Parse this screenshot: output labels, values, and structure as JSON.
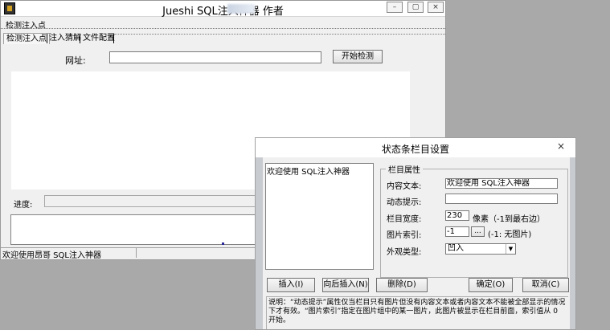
{
  "main": {
    "title": "Jueshi SQL注入神器 作者",
    "menu": "检测注入点",
    "tabs": [
      "检测注入点",
      "注入猜解",
      "文件配置"
    ],
    "url_label": "网址:",
    "url_value": "",
    "start_button": "开始检测",
    "progress_label": "进度:",
    "status_text": "欢迎使用昂哥 SQL注入神器"
  },
  "dialog": {
    "title": "状态条栏目设置",
    "close_glyph": "×",
    "list_items": [
      "欢迎使用 SQL注入神器"
    ],
    "group_title": "栏目属性",
    "labels": {
      "content": "内容文本:",
      "tip": "动态提示:",
      "width": "栏目宽度:",
      "image": "图片索引:",
      "shape": "外观类型:"
    },
    "content_value": "欢迎使用 SQL注入神器",
    "tip_value": "",
    "width_value": "230",
    "width_hint": "像素（-1到最右边）",
    "image_value": "-1",
    "image_button": "...",
    "image_hint": "(-1: 无图片)",
    "shape_value": "凹入",
    "buttons": {
      "insert": "插入(I)",
      "insert_after": "向后插入(N)",
      "delete": "删除(D)",
      "ok": "确定(O)",
      "cancel": "取消(C)"
    },
    "note": "说明：“动态提示”属性仅当栏目只有图片但没有内容文本或者内容文本不能被全部显示的情况下才有效。“图片索引”指定在图片组中的某一图片，此图片被显示在栏目前面，索引值从 0 开始。"
  },
  "colors": {
    "desktop": "#a9a9a9",
    "window_bg": "#f0f0f0",
    "input_bg": "#ffffff"
  }
}
